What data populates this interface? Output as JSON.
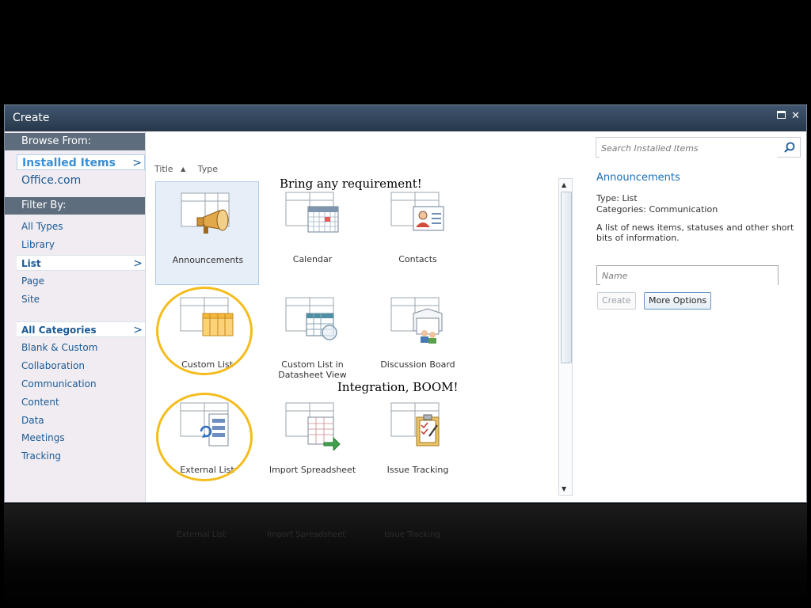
{
  "dialog": {
    "title": "Create",
    "maximize_symbol": "🗖",
    "close_symbol": "✕"
  },
  "sidebar": {
    "browse_header": "Browse From:",
    "browse_items": [
      {
        "label": "Installed Items",
        "selected": true
      },
      {
        "label": "Office.com",
        "selected": false
      }
    ],
    "filter_header": "Filter By:",
    "type_items": [
      {
        "label": "All Types",
        "selected": false
      },
      {
        "label": "Library",
        "selected": false
      },
      {
        "label": "List",
        "selected": true
      },
      {
        "label": "Page",
        "selected": false
      },
      {
        "label": "Site",
        "selected": false
      }
    ],
    "category_items": [
      {
        "label": "All Categories",
        "selected": true
      },
      {
        "label": "Blank & Custom",
        "selected": false
      },
      {
        "label": "Collaboration",
        "selected": false
      },
      {
        "label": "Communication",
        "selected": false
      },
      {
        "label": "Content",
        "selected": false
      },
      {
        "label": "Data",
        "selected": false
      },
      {
        "label": "Meetings",
        "selected": false
      },
      {
        "label": "Tracking",
        "selected": false
      }
    ],
    "chevron": ">"
  },
  "sort": {
    "title_label": "Title",
    "arrow": "▲",
    "type_label": "Type"
  },
  "tiles": [
    {
      "label": "Announcements",
      "icon": "megaphone-icon",
      "selected": true
    },
    {
      "label": "Calendar",
      "icon": "calendar-icon",
      "selected": false
    },
    {
      "label": "Contacts",
      "icon": "contact-card-icon",
      "selected": false
    },
    {
      "label": "Custom List",
      "icon": "custom-list-icon",
      "selected": false
    },
    {
      "label": "Custom List in Datasheet View",
      "icon": "datasheet-icon",
      "selected": false
    },
    {
      "label": "Discussion Board",
      "icon": "discussion-icon",
      "selected": false
    },
    {
      "label": "External List",
      "icon": "external-list-icon",
      "selected": false
    },
    {
      "label": "Import Spreadsheet",
      "icon": "import-spreadsheet-icon",
      "selected": false
    },
    {
      "label": "Issue Tracking",
      "icon": "issue-tracking-icon",
      "selected": false
    }
  ],
  "search": {
    "placeholder": "Search Installed Items"
  },
  "details": {
    "title": "Announcements",
    "type_line": "Type: List",
    "categories_line": "Categories: Communication",
    "description": "A list of news items, statuses and other short bits of information.",
    "name_placeholder": "Name",
    "create_label": "Create",
    "more_options_label": "More Options"
  },
  "annotations": {
    "callout_1": "Bring any requirement!",
    "callout_2": "Integration, BOOM!",
    "highlight_color": "#f5bc1c"
  },
  "colors": {
    "accent": "#1a6fb5",
    "titlebar": "#2d4056",
    "sidebar_header": "#5e6d7d"
  }
}
